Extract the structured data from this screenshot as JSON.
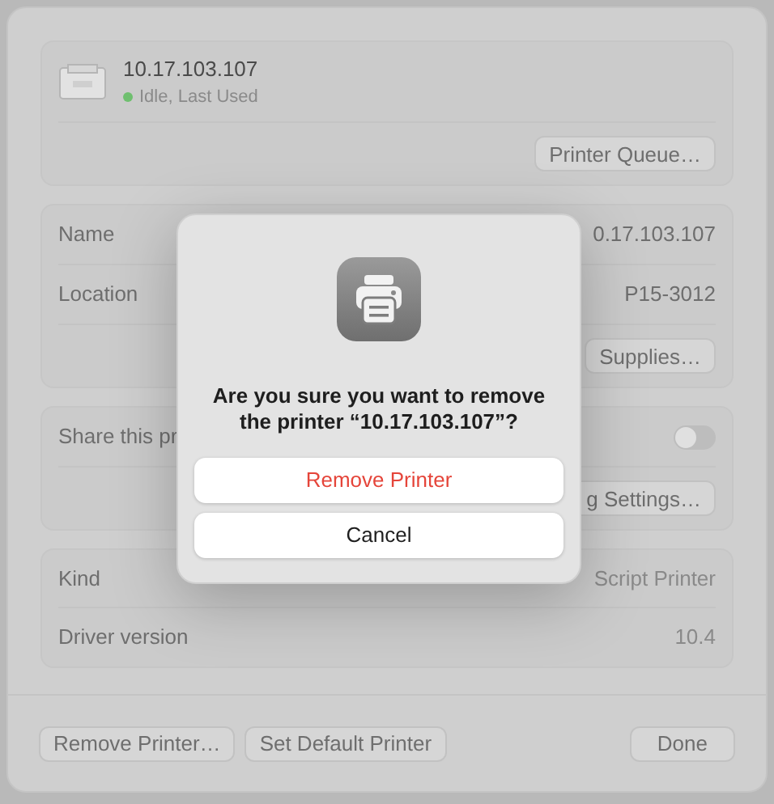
{
  "printer": {
    "name": "10.17.103.107",
    "status": "Idle, Last Used",
    "queue_button": "Printer Queue…"
  },
  "details": [
    {
      "label": "Name",
      "value": "0.17.103.107"
    },
    {
      "label": "Location",
      "value": "P15-3012"
    }
  ],
  "supplies_button": "Supplies…",
  "share": {
    "label": "Share this pr",
    "on": false,
    "settings_button": "g Settings…"
  },
  "info": [
    {
      "label": "Kind",
      "value": "Script Printer"
    },
    {
      "label": "Driver version",
      "value": "10.4"
    }
  ],
  "footer": {
    "remove_button": "Remove Printer…",
    "default_button": "Set Default Printer",
    "done_button": "Done"
  },
  "alert": {
    "title": "Are you sure you want to remove the printer “10.17.103.107”?",
    "buttons": [
      {
        "label": "Remove Printer",
        "kind": "destructive"
      },
      {
        "label": "Cancel",
        "kind": "normal"
      }
    ]
  }
}
